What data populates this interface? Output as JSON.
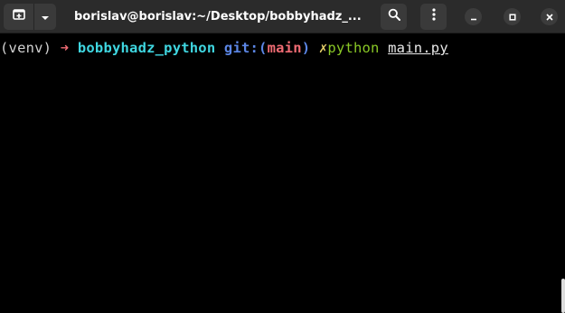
{
  "window": {
    "title": "borislav@borislav:~/Desktop/bobbyhadz_..."
  },
  "headerbar": {
    "new_tab_icon": "new-tab-icon",
    "dropdown_icon": "chevron-down-icon",
    "search_icon": "search-icon",
    "menu_icon": "kebab-menu-icon",
    "minimize_icon": "minimize-icon",
    "maximize_icon": "maximize-icon",
    "close_icon": "close-icon"
  },
  "terminal": {
    "venv": "(venv)",
    "arrow": "➜",
    "directory": "bobbyhadz_python",
    "git_label": "git:",
    "branch_open": "(",
    "branch": "main",
    "branch_close": ")",
    "dirty_mark": "✗",
    "command": "python",
    "argument": "main.py"
  },
  "colors": {
    "background": "#000000",
    "headerbar": "#2b2b2b",
    "arrow": "#ef6b73",
    "directory": "#3fd6e0",
    "git": "#5b86e5",
    "branch": "#ef6b73",
    "dirty": "#e8d16a",
    "command": "#8ac926"
  }
}
